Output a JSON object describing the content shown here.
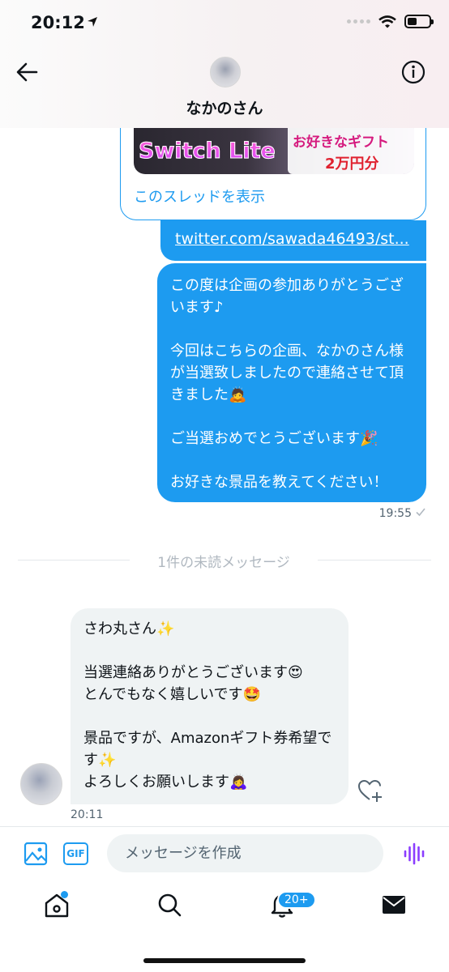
{
  "status_bar": {
    "time": "20:12"
  },
  "header": {
    "name": "なかのさん"
  },
  "card": {
    "image_text_switch": "Switch Lite",
    "image_text_gift": "お好きなギフト",
    "image_text_amount": "2万円分",
    "thread_link": "このスレッドを表示"
  },
  "link_message": "twitter.com/sawada46493/st...",
  "sent_message": {
    "p1": "この度は企画の参加ありがとうございます♪",
    "p2": "今回はこちらの企画、なかのさん様が当選致しましたので連絡させて頂きました🙇",
    "p3": "ご当選おめでとうございます🎉",
    "p4": "お好きな景品を教えてください！",
    "time": "19:55"
  },
  "divider_label": "1件の未読メッセージ",
  "received_message": {
    "line1": "さわ丸さん✨",
    "line2": "当選連絡ありがとうございます😍",
    "line3": "とんでもなく嬉しいです🤩",
    "line4": "景品ですが、Amazonギフト券希望です✨",
    "line5": "よろしくお願いします🙇‍♀️",
    "time": "20:11"
  },
  "composer": {
    "gif_label": "GIF",
    "placeholder": "メッセージを作成"
  },
  "tabbar": {
    "notifications_badge": "20+"
  },
  "colors": {
    "accent": "#1d9bf0",
    "bubble_received": "#eff3f4",
    "voice": "#8b3dff"
  },
  "icons": [
    "back-arrow-icon",
    "info-icon",
    "location-arrow-icon",
    "wifi-icon",
    "battery-icon",
    "heart-plus-icon",
    "image-icon",
    "gif-icon",
    "voice-icon",
    "home-icon",
    "search-icon",
    "bell-icon",
    "mail-icon",
    "checkmark-icon"
  ]
}
